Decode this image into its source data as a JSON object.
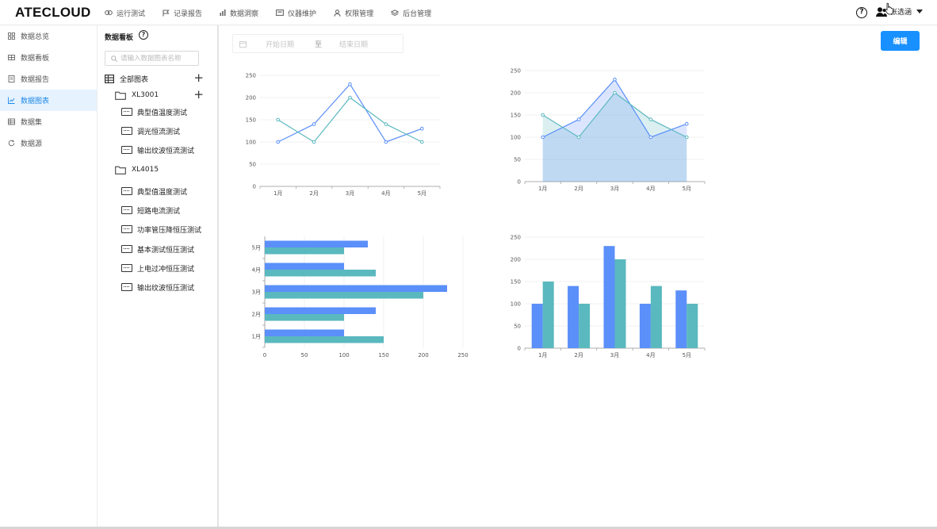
{
  "app": {
    "logo": "ATECLOUD"
  },
  "topnav": [
    {
      "label": "运行测试",
      "icon": "link-icon"
    },
    {
      "label": "记录报告",
      "icon": "flag-icon"
    },
    {
      "label": "数据洞察",
      "icon": "bar-chart-icon"
    },
    {
      "label": "仪器维护",
      "icon": "instrument-icon"
    },
    {
      "label": "权限管理",
      "icon": "user-icon"
    },
    {
      "label": "后台管理",
      "icon": "layers-icon"
    }
  ],
  "header": {
    "help": "?",
    "user_name": "张选涵"
  },
  "sidebar": {
    "items": [
      {
        "label": "数据总览",
        "icon": "grid-icon",
        "active": false
      },
      {
        "label": "数据看板",
        "icon": "board-icon",
        "active": false
      },
      {
        "label": "数据报告",
        "icon": "report-icon",
        "active": false
      },
      {
        "label": "数据图表",
        "icon": "chart-icon",
        "active": true
      },
      {
        "label": "数据集",
        "icon": "table-icon",
        "active": false
      },
      {
        "label": "数据源",
        "icon": "refresh-icon",
        "active": false
      }
    ]
  },
  "panel": {
    "title": "数据看板",
    "help": "?",
    "search_placeholder": "请输入数据图表名称",
    "root_label": "全部图表",
    "folders": [
      {
        "label": "XL3001",
        "items": [
          "典型值温度测试",
          "调光恒流测试",
          "输出纹波恒流测试"
        ]
      },
      {
        "label": "XL4015",
        "items": [
          "典型值温度测试",
          "短路电流测试",
          "功率管压降恒压测试",
          "基本测试恒压测试",
          "上电过冲恒压测试",
          "输出纹波恒压测试"
        ]
      }
    ]
  },
  "main": {
    "date_start": "开始日期",
    "date_sep": "至",
    "date_end": "结束日期",
    "edit_label": "编辑"
  },
  "colors": {
    "series_a": "#5b8ff9",
    "series_b": "#5ab8bf",
    "accent": "#1890ff"
  },
  "chart_data": [
    {
      "type": "line",
      "categories": [
        "1月",
        "2月",
        "3月",
        "4月",
        "5月"
      ],
      "series": [
        {
          "values": [
            100,
            140,
            230,
            100,
            130
          ],
          "color": "#5b8ff9"
        },
        {
          "values": [
            150,
            100,
            200,
            140,
            100
          ],
          "color": "#5ab8bf"
        }
      ],
      "ylim": [
        0,
        250
      ],
      "yticks": [
        0,
        50,
        100,
        150,
        200,
        250
      ],
      "grid": true
    },
    {
      "type": "area",
      "categories": [
        "1月",
        "2月",
        "3月",
        "4月",
        "5月"
      ],
      "series": [
        {
          "values": [
            100,
            140,
            230,
            100,
            130
          ],
          "color": "#5b8ff9"
        },
        {
          "values": [
            150,
            100,
            200,
            140,
            100
          ],
          "color": "#5ab8bf"
        }
      ],
      "ylim": [
        0,
        250
      ],
      "yticks": [
        0,
        50,
        100,
        150,
        200,
        250
      ],
      "grid": true
    },
    {
      "type": "bar",
      "orientation": "horizontal",
      "categories": [
        "1月",
        "2月",
        "3月",
        "4月",
        "5月"
      ],
      "series": [
        {
          "values": [
            100,
            140,
            230,
            100,
            130
          ],
          "color": "#5b8ff9"
        },
        {
          "values": [
            150,
            100,
            200,
            140,
            100
          ],
          "color": "#5ab8bf"
        }
      ],
      "xlim": [
        0,
        250
      ],
      "xticks": [
        0,
        50,
        100,
        150,
        200,
        250
      ],
      "grid": true
    },
    {
      "type": "bar",
      "orientation": "vertical",
      "categories": [
        "1月",
        "2月",
        "3月",
        "4月",
        "5月"
      ],
      "series": [
        {
          "values": [
            100,
            140,
            230,
            100,
            130
          ],
          "color": "#5b8ff9"
        },
        {
          "values": [
            150,
            100,
            200,
            140,
            100
          ],
          "color": "#5ab8bf"
        }
      ],
      "ylim": [
        0,
        250
      ],
      "yticks": [
        0,
        50,
        100,
        150,
        200,
        250
      ],
      "grid": true
    }
  ]
}
